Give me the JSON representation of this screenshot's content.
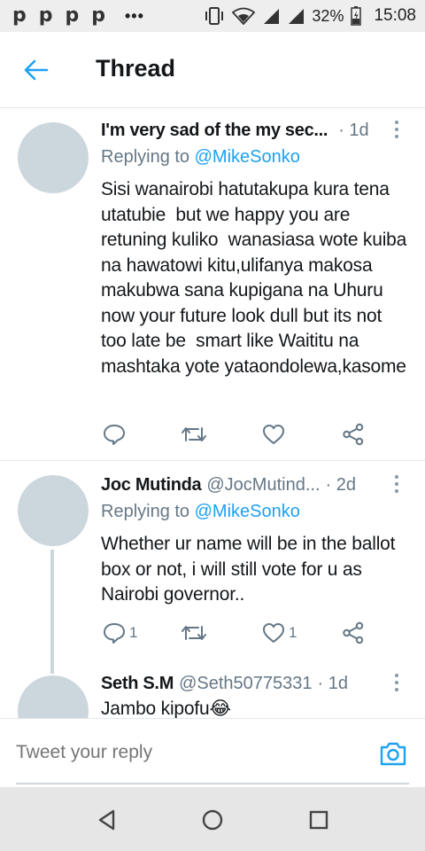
{
  "status_bar": {
    "app_icons": [
      "p",
      "p",
      "p",
      "p"
    ],
    "more_dots": "•••",
    "battery_percent": "32%",
    "time": "15:08"
  },
  "header": {
    "title": "Thread"
  },
  "tweets": [
    {
      "name": "I'm very sad of the my sec...",
      "handle": "",
      "time": "· 1d",
      "replying_prefix": "Replying to",
      "replying_to": "@MikeSonko",
      "text": "Sisi wanairobi hatutakupa kura tena utatubie  but we happy you are retuning kuliko  wanasiasa wote kuiba na hawatowi kitu,ulifanya makosa makubwa sana kupigana na Uhuru now your future look dull but its not too late be  smart like Waititu na  mashtaka yote yataondolewa,kasome",
      "reply_count": "",
      "like_count": ""
    },
    {
      "name": "Joc Mutinda",
      "handle": "@JocMutind...",
      "time": "· 2d",
      "replying_prefix": "Replying to",
      "replying_to": "@MikeSonko",
      "text": "Whether ur name will be in the ballot box or not, i will still vote for u as Nairobi governor..",
      "reply_count": "1",
      "like_count": "1"
    },
    {
      "name": "Seth S.M",
      "handle": "@Seth50775331",
      "time": "· 1d",
      "text": "Jambo kipofu😂"
    }
  ],
  "reply_bar": {
    "placeholder": "Tweet your reply"
  },
  "colors": {
    "accent": "#1da1f2",
    "secondary_text": "#657786",
    "avatar_placeholder": "#ccd6dd",
    "divider": "#e1e8ed"
  },
  "icons": {
    "back": "arrow-left-icon",
    "reply": "reply-bubble-icon",
    "retweet": "retweet-icon",
    "like": "heart-icon",
    "share": "share-icon",
    "camera": "camera-icon",
    "nav_back": "triangle-back-icon",
    "nav_home": "circle-home-icon",
    "nav_recents": "square-recents-icon"
  }
}
